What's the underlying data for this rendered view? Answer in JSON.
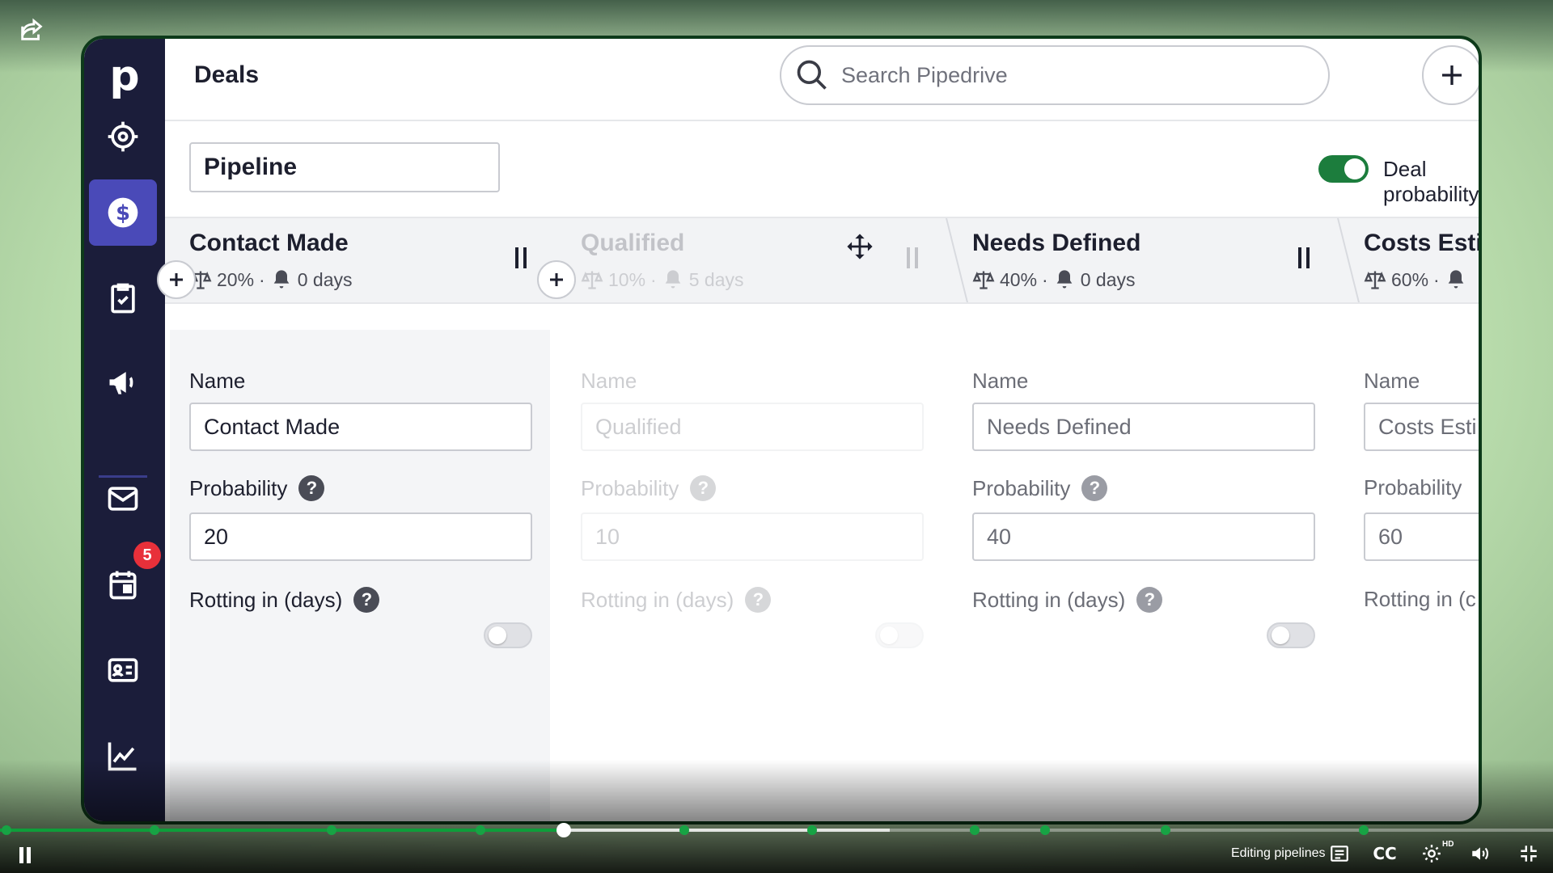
{
  "app": {
    "page_title": "Deals",
    "search_placeholder": "Search Pipedrive",
    "pipeline_name": "Pipeline",
    "deal_probability_label": "Deal probability",
    "deal_probability_on": true,
    "sidebar": {
      "logo": "p",
      "items": [
        {
          "icon": "target-icon",
          "active": false
        },
        {
          "icon": "dollar-icon",
          "active": true
        },
        {
          "icon": "clipboard-check-icon",
          "active": false
        },
        {
          "icon": "megaphone-icon",
          "active": false
        },
        {
          "icon": "mail-icon",
          "active": false
        },
        {
          "icon": "calendar-icon",
          "active": false,
          "badge": "5"
        },
        {
          "icon": "contact-card-icon",
          "active": false
        },
        {
          "icon": "chart-icon",
          "active": false
        }
      ]
    },
    "stages": [
      {
        "title": "Contact Made",
        "probability_text": "20%",
        "rotting_text": "0 days",
        "name_label": "Name",
        "name_value": "Contact Made",
        "probability_label": "Probability",
        "probability_value": "20",
        "rotting_label": "Rotting in (days)"
      },
      {
        "title": "Qualified",
        "probability_text": "10%",
        "rotting_text": "5 days",
        "name_label": "Name",
        "name_value": "Qualified",
        "probability_label": "Probability",
        "probability_value": "10",
        "rotting_label": "Rotting in (days)"
      },
      {
        "title": "Needs Defined",
        "probability_text": "40%",
        "rotting_text": "0 days",
        "name_label": "Name",
        "name_value": "Needs Defined",
        "probability_label": "Probability",
        "probability_value": "40",
        "rotting_label": "Rotting in (days)"
      },
      {
        "title": "Costs Esti",
        "probability_text": "60%",
        "rotting_text": "",
        "name_label": "Name",
        "name_value": "Costs Esti",
        "probability_label": "Probability",
        "probability_value": "60",
        "rotting_label": "Rotting in (c"
      }
    ],
    "meta_separator": "·",
    "help_glyph": "?"
  },
  "player": {
    "chapter_title": "Editing pipelines",
    "cc_label": "CC",
    "hd_label": "HD",
    "progress_fraction": 0.363,
    "buffered_fraction": 0.573,
    "colors": {
      "accent": "#17a344",
      "sidebar": "#1b1d3a",
      "active_nav": "#4a4ab8",
      "badge": "#e8303a"
    }
  }
}
